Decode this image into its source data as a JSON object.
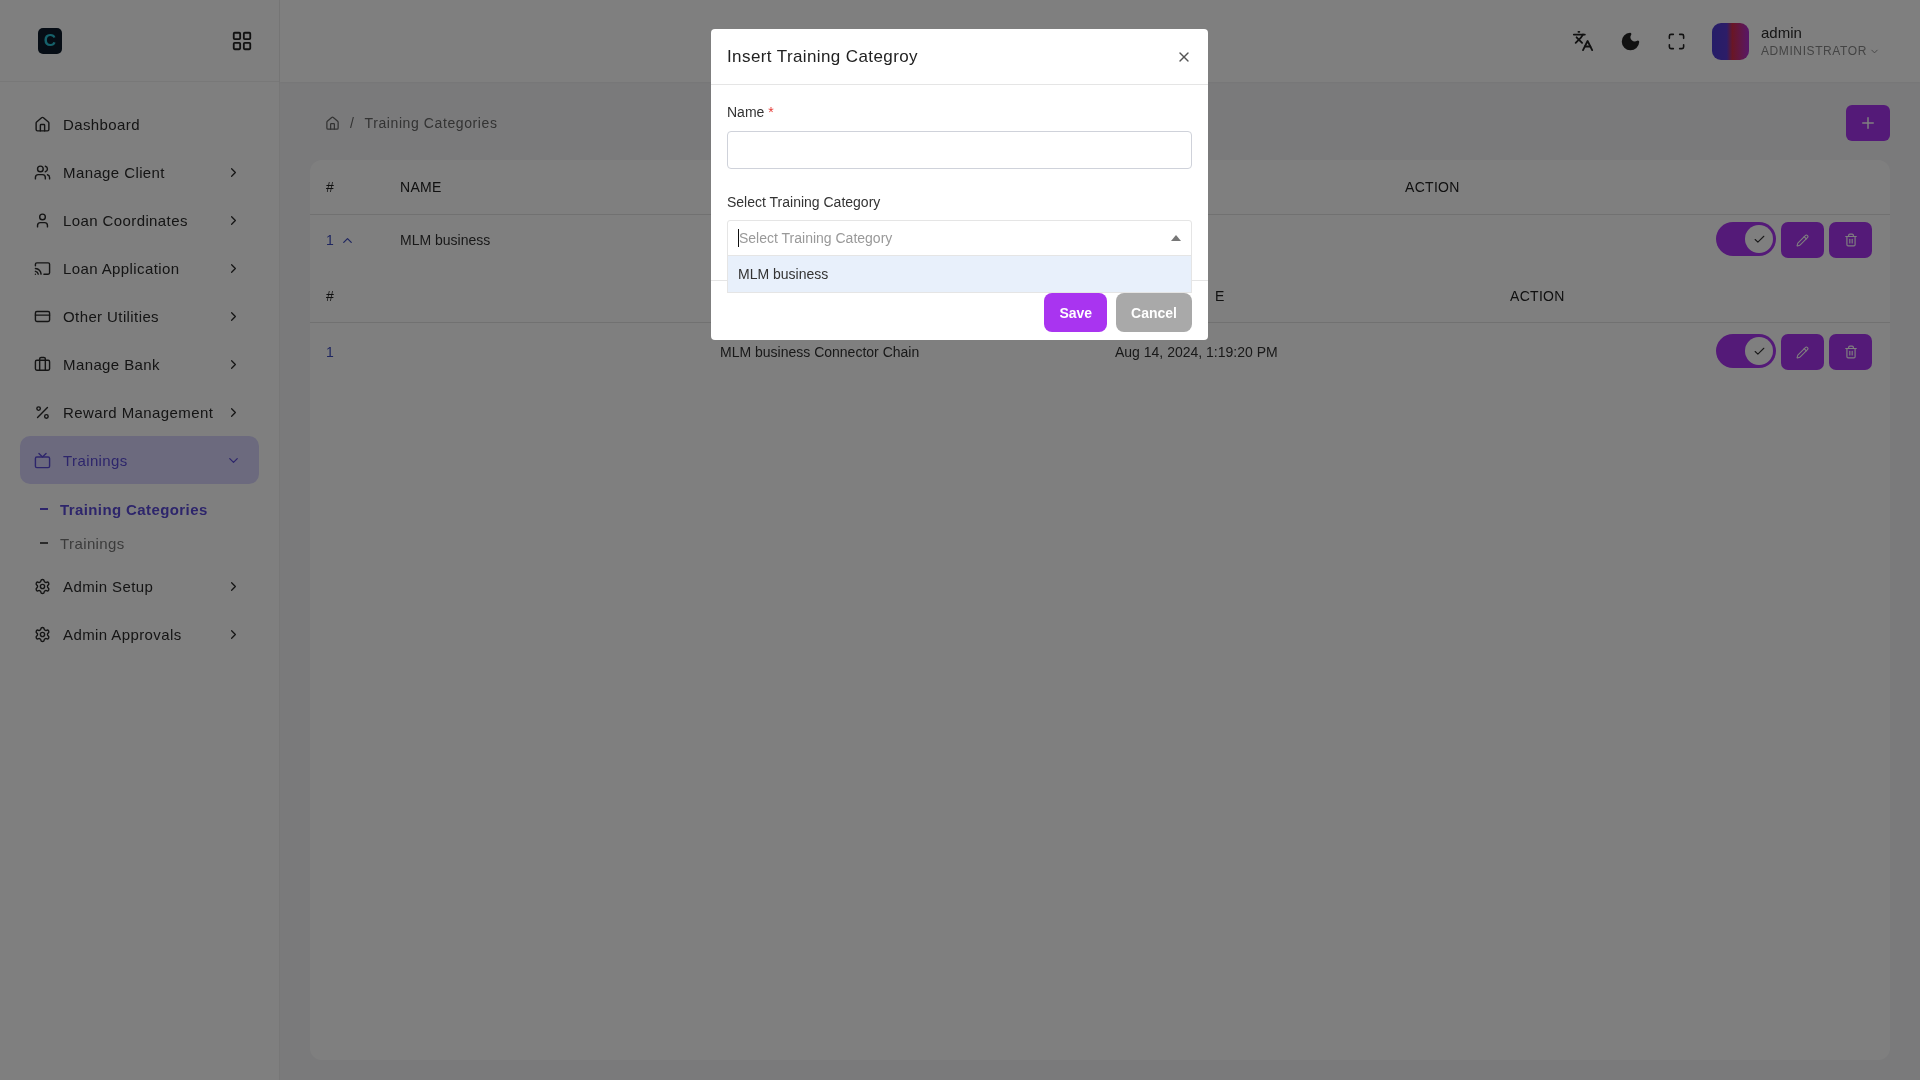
{
  "logo": {
    "letter": "C"
  },
  "sidebar": {
    "items": [
      {
        "label": "Dashboard",
        "has_children": false,
        "selected": false
      },
      {
        "label": "Manage Client",
        "has_children": true,
        "expanded": false,
        "selected": false
      },
      {
        "label": "Loan Coordinates",
        "has_children": true,
        "expanded": false,
        "selected": false
      },
      {
        "label": "Loan Application",
        "has_children": true,
        "expanded": false,
        "selected": false
      },
      {
        "label": "Other Utilities",
        "has_children": true,
        "expanded": false,
        "selected": false
      },
      {
        "label": "Manage Bank",
        "has_children": true,
        "expanded": false,
        "selected": false
      },
      {
        "label": "Reward Management",
        "has_children": true,
        "expanded": false,
        "selected": false
      },
      {
        "label": "Trainings",
        "has_children": true,
        "expanded": true,
        "selected": true,
        "children": [
          {
            "label": "Training Categories",
            "selected": true
          },
          {
            "label": "Trainings",
            "selected": false
          }
        ]
      },
      {
        "label": "Admin Setup",
        "has_children": true,
        "expanded": false,
        "selected": false
      },
      {
        "label": "Admin Approvals",
        "has_children": true,
        "expanded": false,
        "selected": false
      }
    ]
  },
  "topbar": {
    "user": {
      "name": "admin",
      "role": "ADMINISTRATOR"
    }
  },
  "breadcrumb": {
    "separator": "/",
    "items": [
      "Training Categories"
    ]
  },
  "table": {
    "columns": [
      "#",
      "NAME",
      "ACTION"
    ],
    "rows": [
      {
        "index": "1",
        "name": "MLM business",
        "expanded": true,
        "active": true,
        "subtable": {
          "header": {
            "column_1": "#",
            "column_3": "E",
            "column_4": "ACTION"
          },
          "rows": [
            {
              "index": "1",
              "name": "MLM business Connector Chain",
              "date": "Aug 14, 2024, 1:19:20 PM",
              "active": true
            }
          ]
        }
      }
    ]
  },
  "modal": {
    "title": "Insert Training Categroy",
    "name_field": {
      "label": "Name",
      "required_mark": "*"
    },
    "select_field": {
      "label": "Select Training Category",
      "placeholder": "Select Training Category",
      "focused": true,
      "open": true,
      "options": [
        {
          "label": "MLM business",
          "highlighted": true
        }
      ]
    },
    "buttons": [
      {
        "label": "Save",
        "kind": "primary",
        "disabled": false
      },
      {
        "label": "Cancel",
        "kind": "secondary",
        "disabled": true
      }
    ]
  }
}
